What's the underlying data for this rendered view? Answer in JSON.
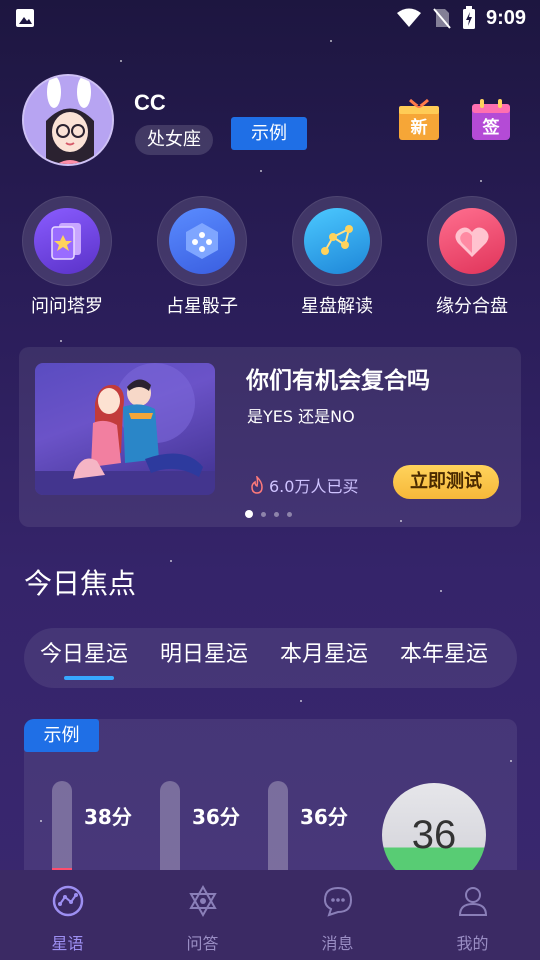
{
  "status_bar": {
    "time": "9:09"
  },
  "profile": {
    "username": "CC",
    "zodiac": "处女座",
    "sample_badge": "示例",
    "new_icon_text": "新",
    "sign_icon_text": "签"
  },
  "features": [
    {
      "label": "问问塔罗",
      "icon": "tarot-icon"
    },
    {
      "label": "占星骰子",
      "icon": "dice-icon"
    },
    {
      "label": "星盘解读",
      "icon": "chart-icon"
    },
    {
      "label": "缘分合盘",
      "icon": "heart-icon"
    }
  ],
  "banner": {
    "title": "你们有机会复合吗",
    "subtitle": "是YES 还是NO",
    "buyers": "6.0万人已买",
    "button": "立即测试",
    "page_count": 4,
    "active_page": 0
  },
  "focus": {
    "title": "今日焦点",
    "tabs": [
      {
        "label": "今日星运",
        "active": true
      },
      {
        "label": "明日星运",
        "active": false
      },
      {
        "label": "本月星运",
        "active": false
      },
      {
        "label": "本年星运",
        "active": false
      }
    ]
  },
  "score_card": {
    "sample_tag": "示例",
    "bars": [
      {
        "label": "38分",
        "value": 38,
        "color": "#ff4d6d"
      },
      {
        "label": "36分",
        "value": 36,
        "color": "#37a8ff"
      },
      {
        "label": "36分",
        "value": 36,
        "color": "#ffa53a"
      }
    ],
    "total": "36"
  },
  "bottom_nav": [
    {
      "label": "星语",
      "icon": "constellation-icon",
      "active": true
    },
    {
      "label": "问答",
      "icon": "star-of-david-icon",
      "active": false
    },
    {
      "label": "消息",
      "icon": "chat-bubble-icon",
      "active": false
    },
    {
      "label": "我的",
      "icon": "person-icon",
      "active": false
    }
  ],
  "colors": {
    "accent_blue": "#1f6fe6",
    "tab_indicator": "#37a8ff",
    "button_yellow": "#f6b83a"
  }
}
